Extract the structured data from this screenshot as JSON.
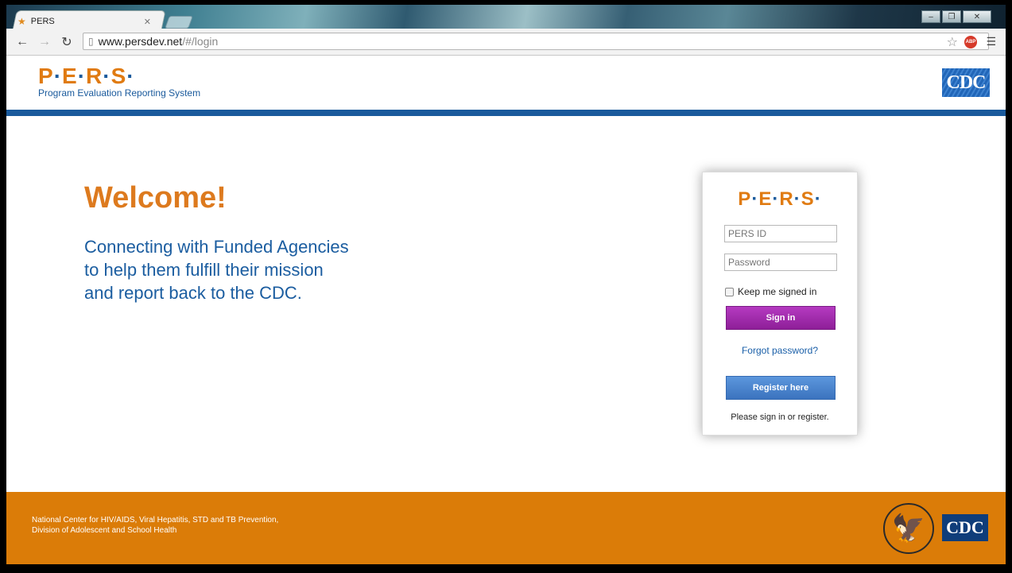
{
  "browser": {
    "tab_title": "PERS",
    "tab_favicon": "star-icon",
    "url_host": "www.persdev.net",
    "url_path": "/#/login",
    "extension_label": "ABP",
    "window_controls": [
      "–",
      "❐",
      "✕"
    ]
  },
  "header": {
    "logo": "P·E·R·S·",
    "subtitle": "Program Evaluation Reporting System",
    "badge": "CDC"
  },
  "hero": {
    "title": "Welcome!",
    "tagline_lines": [
      "Connecting with Funded Agencies",
      "to help them fulfill their mission",
      "and report back to the CDC."
    ]
  },
  "login": {
    "logo": "P·E·R·S·",
    "id_placeholder": "PERS ID",
    "password_placeholder": "Password",
    "remember_label": "Keep me signed in",
    "signin_label": "Sign in",
    "forgot_label": "Forgot password?",
    "register_label": "Register here",
    "prompt": "Please sign in or register."
  },
  "footer": {
    "line1": "National Center for HIV/AIDS, Viral Hepatitis, STD and TB Prevention,",
    "line2": "Division of Adolescent and School Health",
    "badge": "CDC"
  },
  "colors": {
    "brand_orange": "#e07b12",
    "brand_blue": "#1a5a9c",
    "signin_purple": "#9c27a8",
    "register_blue": "#4a85cd",
    "footer_orange": "#db7c08"
  }
}
